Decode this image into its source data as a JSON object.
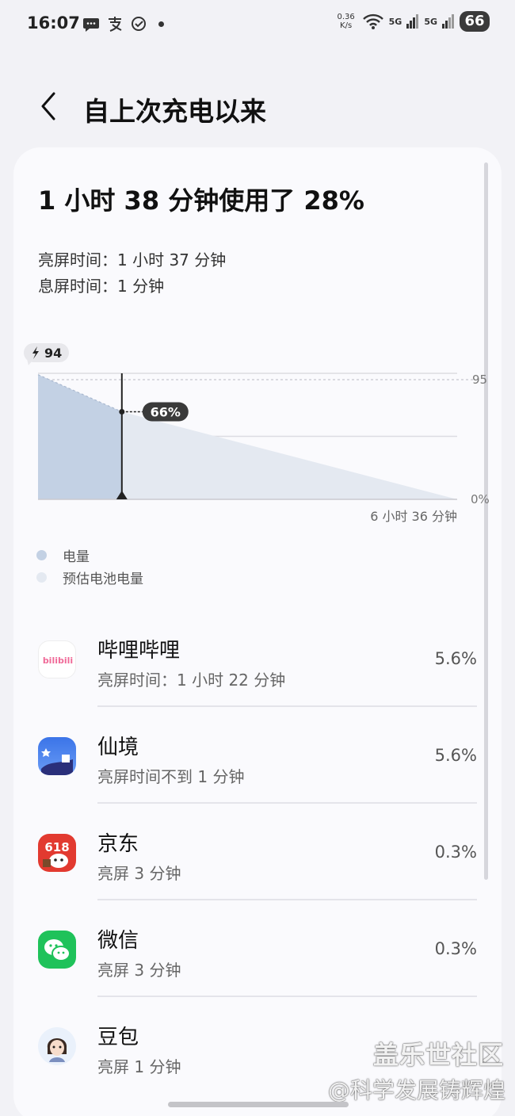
{
  "status_bar": {
    "time": "16:07",
    "net_speed_value": "0.36",
    "net_speed_unit": "K/s",
    "signal1": "5G",
    "signal2": "5G",
    "battery": "66",
    "icons_left": [
      "message-icon",
      "alipay-icon",
      "check-icon"
    ]
  },
  "header": {
    "title": "自上次充电以来"
  },
  "summary": {
    "headline": "1 小时 38 分钟使用了 28%",
    "screen_on": "亮屏时间：1 小时 37 分钟",
    "screen_off": "息屏时间：1 分钟"
  },
  "chart_data": {
    "type": "area",
    "start_label": "94",
    "cursor_label": "66%",
    "y_tick_labels": [
      "95",
      "0%"
    ],
    "x_end_label": "6 小时 36 分钟",
    "ylim": [
      0,
      95
    ],
    "series": [
      {
        "name": "电量",
        "x_fraction": [
          0,
          0.2
        ],
        "values": [
          94,
          66
        ]
      },
      {
        "name": "预估电池电量",
        "x_fraction": [
          0.2,
          1.0
        ],
        "values": [
          66,
          0
        ]
      }
    ],
    "colors": {
      "actual": "#c3d1e4",
      "estimated": "#e4e9f1"
    }
  },
  "legend": [
    {
      "label": "电量",
      "color": "#c3d1e4"
    },
    {
      "label": "预估电池电量",
      "color": "#e4e9f1"
    }
  ],
  "apps": [
    {
      "name": "哔哩哔哩",
      "detail": "亮屏时间：1 小时 22 分钟",
      "percent": "5.6%",
      "icon_text": "bilibili"
    },
    {
      "name": "仙境",
      "detail": "亮屏时间不到 1 分钟",
      "percent": "5.6%"
    },
    {
      "name": "京东",
      "detail": "亮屏 3 分钟",
      "percent": "0.3%",
      "icon_text": "618"
    },
    {
      "name": "微信",
      "detail": "亮屏 3 分钟",
      "percent": "0.3%"
    },
    {
      "name": "豆包",
      "detail": "亮屏 1 分钟",
      "percent": ""
    }
  ],
  "watermark": {
    "line1": "盖乐世社区",
    "line2": "@科学发展铸辉煌"
  }
}
